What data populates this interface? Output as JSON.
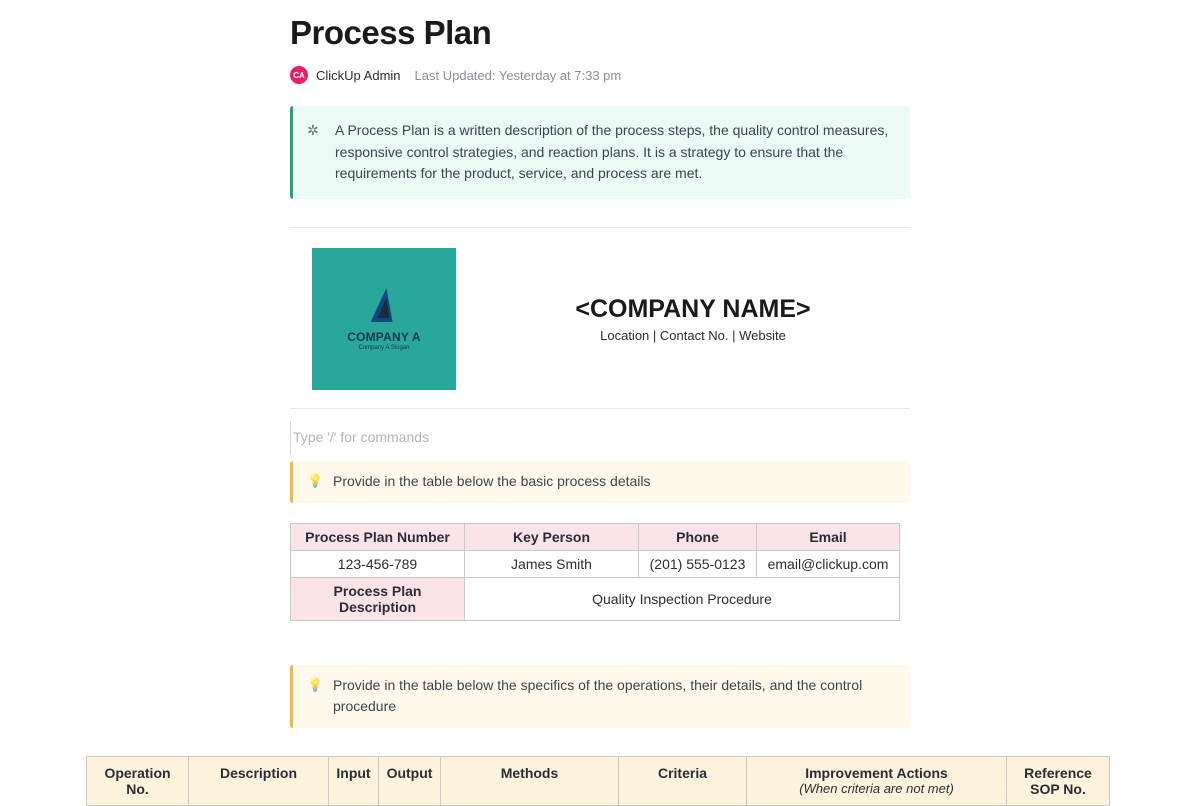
{
  "title": "Process Plan",
  "meta": {
    "avatar_initials": "CA",
    "author": "ClickUp Admin",
    "updated": "Last Updated: Yesterday at 7:33 pm"
  },
  "intro_callout": "A Process Plan is a written description of the process steps, the quality control measures, responsive control strategies, and reaction plans. It is a strategy to ensure that the requirements for the product, service, and process are met.",
  "logo": {
    "line1": "COMPANY A",
    "line2": "Company A Slogan"
  },
  "company": {
    "name": "<COMPANY NAME>",
    "sub": "Location | Contact No. | Website"
  },
  "command_placeholder": "Type '/' for commands",
  "tip1": "Provide in the table below the basic process details",
  "details": {
    "headers": [
      "Process Plan Number",
      "Key Person",
      "Phone",
      "Email"
    ],
    "values": [
      "123-456-789",
      "James Smith",
      "(201) 555-0123",
      "email@clickup.com"
    ],
    "desc_label": "Process Plan Description",
    "desc_value": "Quality Inspection Procedure"
  },
  "tip2": "Provide in the table below the specifics of the operations, their details, and the control procedure",
  "ops_headers": {
    "c1": "Operation No.",
    "c2": "Description",
    "c3": "Input",
    "c4": "Output",
    "c5": "Methods",
    "c6": "Criteria",
    "c7": "Improvement Actions",
    "c7_sub": "(When criteria are not met)",
    "c8": "Reference SOP No."
  }
}
